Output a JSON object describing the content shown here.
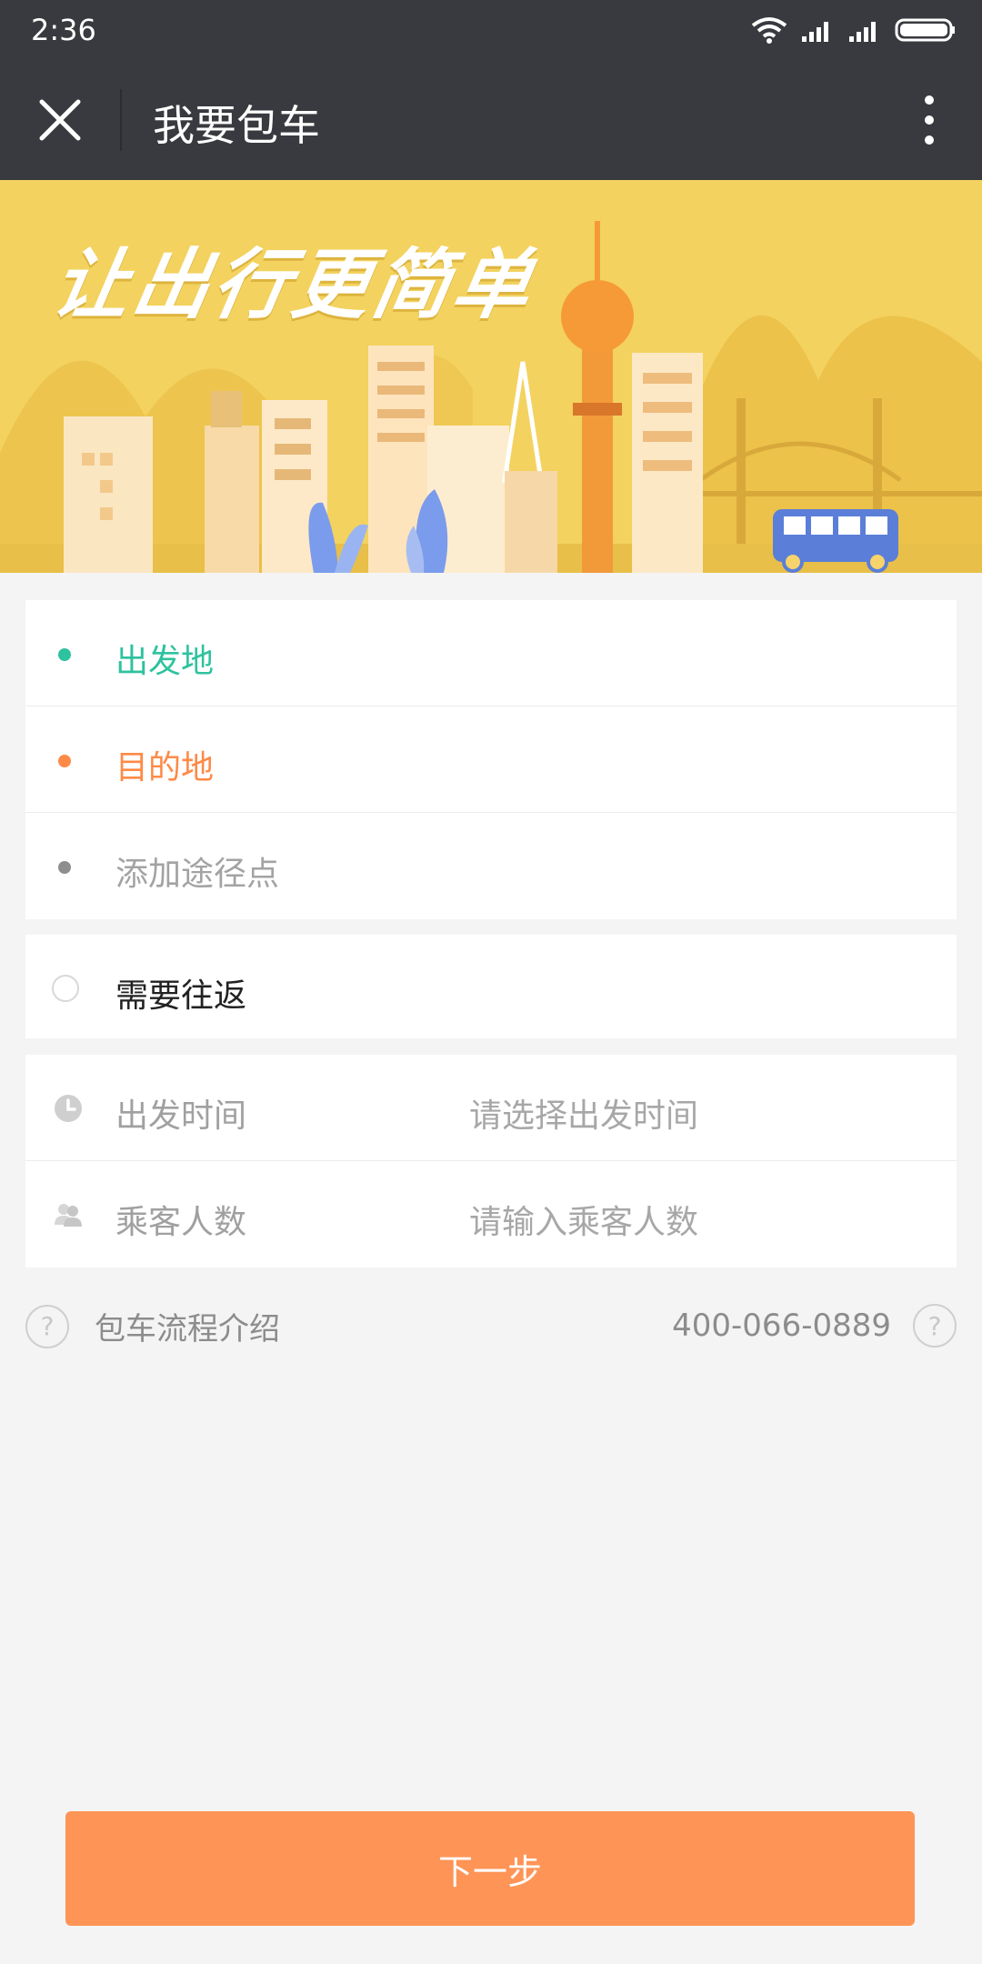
{
  "status_bar": {
    "time": "2:36"
  },
  "nav": {
    "title": "我要包车"
  },
  "banner": {
    "slogan": "让出行更简单"
  },
  "route": {
    "origin": {
      "label": "出发地",
      "color": "#2ec29e"
    },
    "destination": {
      "label": "目的地",
      "color": "#fe8a47"
    },
    "waypoint": {
      "label": "添加途径点",
      "color": "#8e8e8e"
    }
  },
  "round_trip": {
    "label": "需要往返",
    "checked": false
  },
  "details": {
    "departure_time": {
      "label": "出发时间",
      "placeholder": "请选择出发时间"
    },
    "passengers": {
      "label": "乘客人数",
      "placeholder": "请输入乘客人数"
    }
  },
  "help": {
    "intro_label": "包车流程介绍",
    "phone": "400-066-0889",
    "question_glyph": "?"
  },
  "actions": {
    "next_label": "下一步"
  },
  "colors": {
    "accent": "#fe9456",
    "navbar": "#393a3f",
    "origin": "#2ec29e",
    "destination": "#fe8a47"
  }
}
